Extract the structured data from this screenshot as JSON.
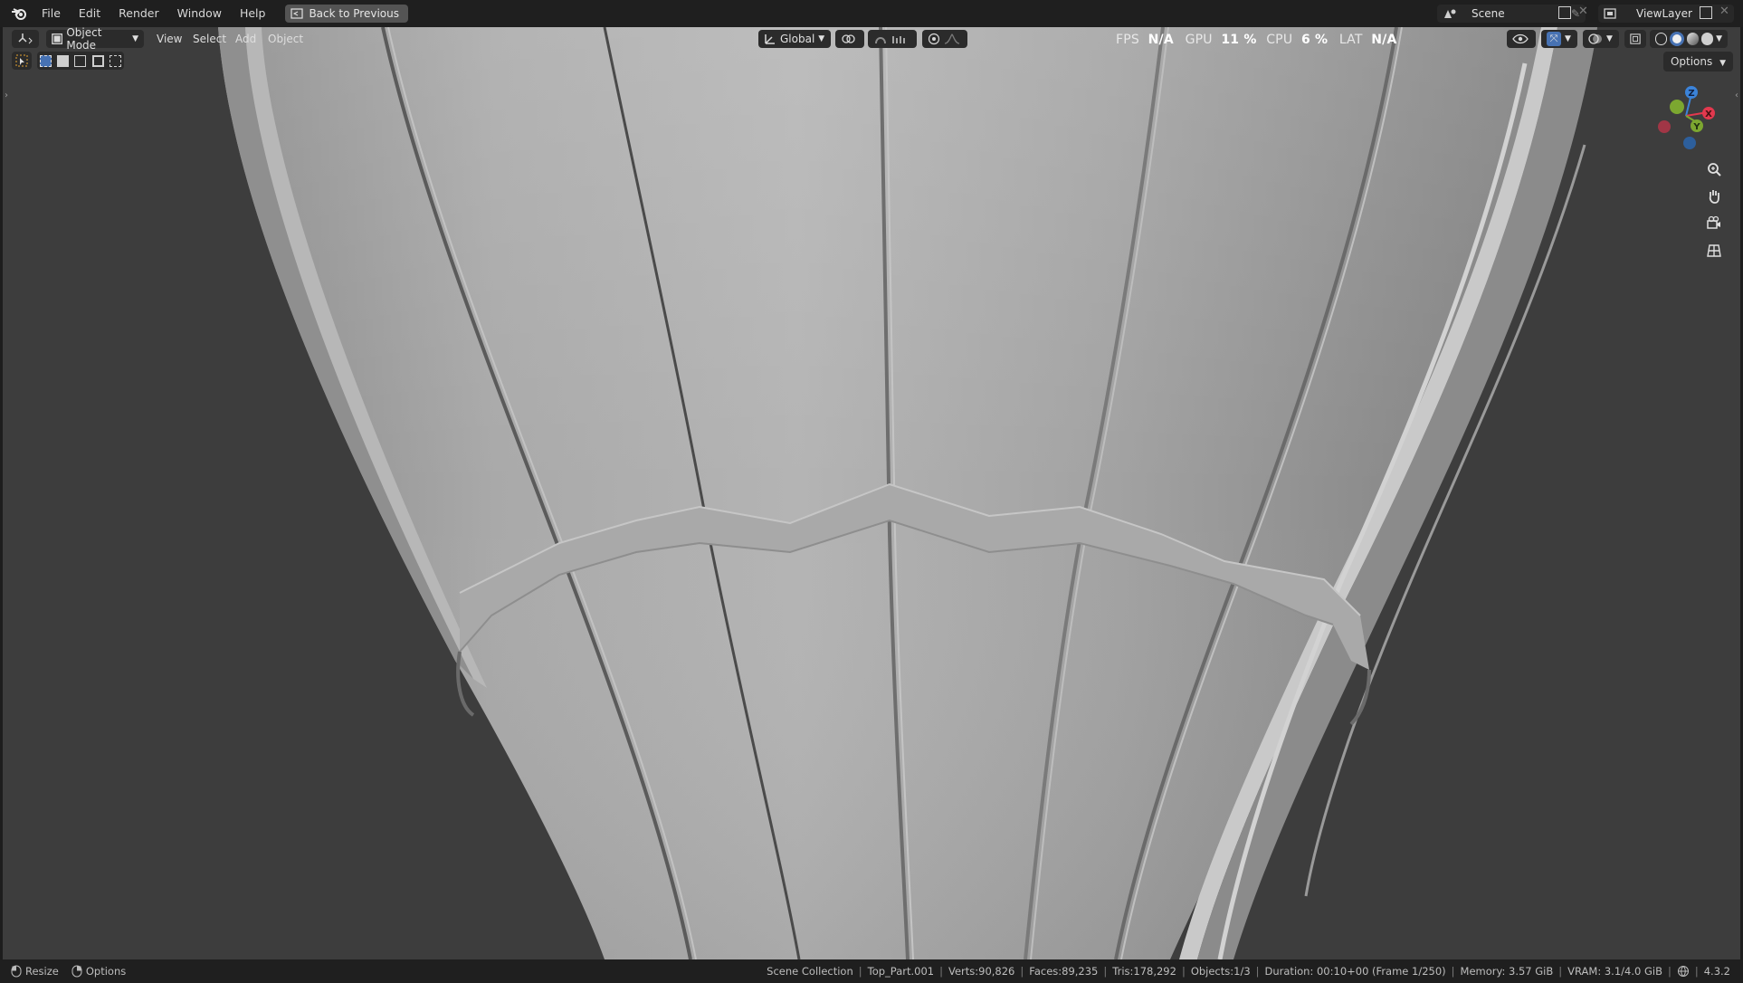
{
  "menubar": {
    "items": [
      "File",
      "Edit",
      "Render",
      "Window",
      "Help"
    ],
    "back_button": "Back to Previous",
    "scene": "Scene",
    "view_layer": "ViewLayer"
  },
  "viewport_header": {
    "mode": "Object Mode",
    "menus": [
      "View",
      "Select",
      "Add",
      "Object"
    ],
    "transform_orientation": "Global",
    "options": "Options"
  },
  "overlay_stats": {
    "fps_label": "FPS",
    "fps_value": "N/A",
    "gpu_label": "GPU",
    "gpu_value": "11 %",
    "cpu_label": "CPU",
    "cpu_value": "6 %",
    "lat_label": "LAT",
    "lat_value": "N/A"
  },
  "navigation_gizmo": {
    "axes": [
      "Z",
      "X",
      "Y"
    ],
    "colors": {
      "x": "#e2384e",
      "y": "#7ca730",
      "z": "#3b83d9"
    }
  },
  "statusbar": {
    "left": [
      "Resize",
      "Options"
    ],
    "collection": "Scene Collection",
    "object": "Top_Part.001",
    "verts": "Verts:90,826",
    "faces": "Faces:89,235",
    "tris": "Tris:178,292",
    "objects": "Objects:1/3",
    "duration": "Duration: 00:10+00 (Frame 1/250)",
    "memory": "Memory: 3.57 GiB",
    "vram": "VRAM: 3.1/4.0 GiB",
    "version": "4.3.2"
  }
}
